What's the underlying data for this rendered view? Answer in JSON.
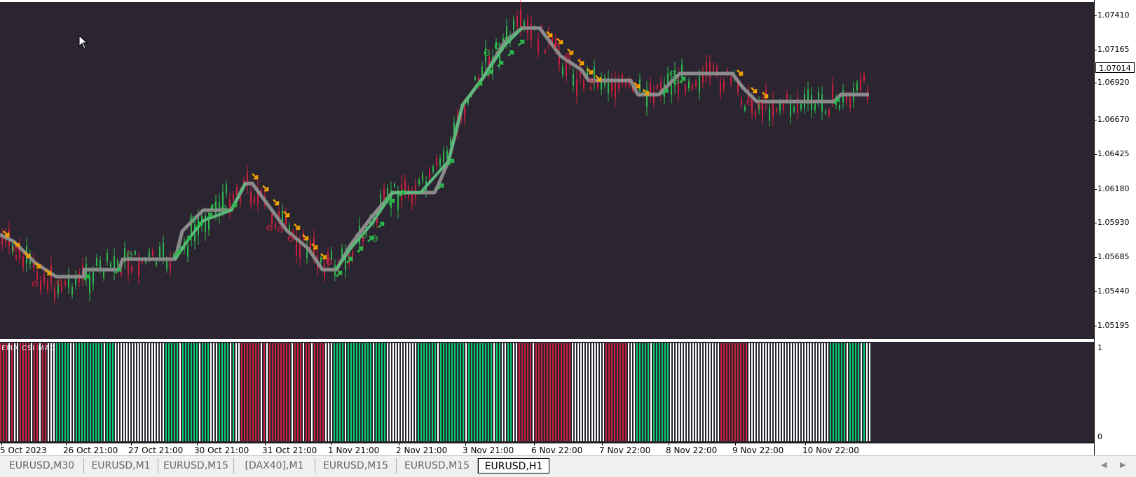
{
  "price_scale": {
    "labels": [
      "1.07410",
      "1.07165",
      "1.06920",
      "1.06670",
      "1.06425",
      "1.06180",
      "1.05930",
      "1.05685",
      "1.05440",
      "1.05195"
    ],
    "current_price": "1.07014"
  },
  "sub_scale": {
    "top": "1",
    "bottom": "0"
  },
  "indicator": {
    "label": "EMA CSI MAC"
  },
  "time_axis": [
    "5 Oct 2023",
    "26 Oct 21:00",
    "27 Oct 21:00",
    "30 Oct 21:00",
    "31 Oct 21:00",
    "1 Nov 21:00",
    "2 Nov 21:00",
    "3 Nov 21:00",
    "6 Nov 22:00",
    "7 Nov 22:00",
    "8 Nov 22:00",
    "9 Nov 22:00",
    "10 Nov 22:00"
  ],
  "tabs": [
    "EURUSD,M30",
    "EURUSD,M1",
    "EURUSD,M15",
    "[DAX40],M1",
    "EURUSD,M15",
    "EURUSD,M15",
    "EURUSD,H1"
  ],
  "active_tab": "EURUSD,H1",
  "colors": {
    "background": "#2a2530",
    "bull": "#2db84d",
    "bear": "#cc1f3d",
    "trend_line": "#8a8a8a",
    "trend_up_line": "#5cb87a",
    "sell_arrow": "#f0a000",
    "buy_arrow": "#2db84d",
    "hist_green": "#00d070",
    "hist_red": "#cc1f3d",
    "hist_white": "#ffffff"
  },
  "icons": {
    "cursor": "mouse-pointer-icon",
    "tab_prev": "chevron-left-icon",
    "tab_next": "chevron-right-icon"
  }
}
